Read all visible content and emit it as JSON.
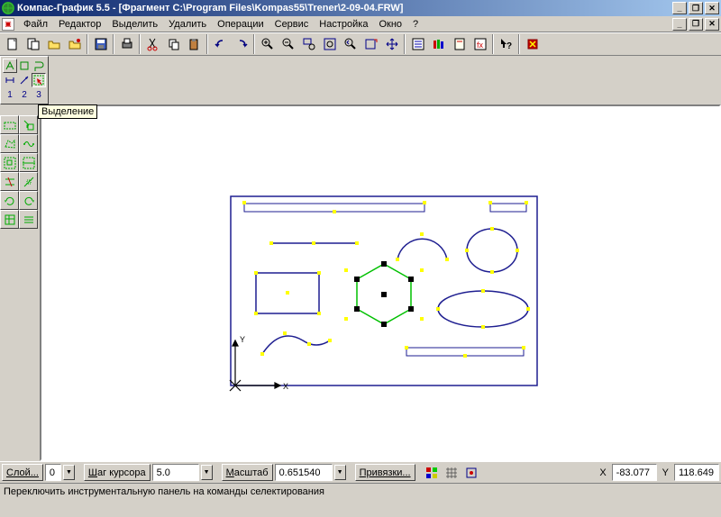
{
  "title": "Компас-График 5.5 - [Фрагмент C:\\Program Files\\Kompas55\\Trener\\2-09-04.FRW]",
  "menu": {
    "i0": "Файл",
    "i1": "Редактор",
    "i2": "Выделить",
    "i3": "Удалить",
    "i4": "Операции",
    "i5": "Сервис",
    "i6": "Настройка",
    "i7": "Окно",
    "i8": "?"
  },
  "tooltip": "Выделение",
  "status": {
    "layer_label": "Слой...",
    "layer_value": "0",
    "cursor_step_label": "Шаг курсора",
    "cursor_step_value": "5.0",
    "scale_label": "Масштаб",
    "scale_value": "0.651540",
    "snap_label": "Привязки...",
    "x_label": "X",
    "x_value": "-83.077",
    "y_label": "Y",
    "y_value": "118.649"
  },
  "statusbar_text": "Переключить инструментальную панель на команды селектирования",
  "tab_numbers": {
    "t1": "1",
    "t2": "2",
    "t3": "3"
  }
}
